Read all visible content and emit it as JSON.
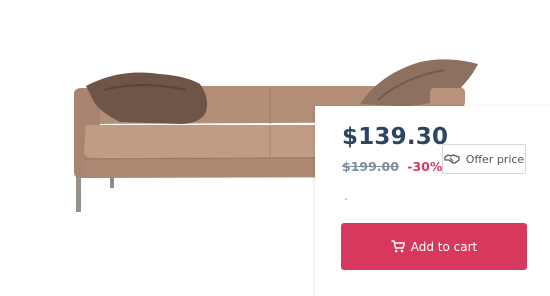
{
  "product": {
    "price_current": "$139.30",
    "price_old": "$199.00",
    "discount": "-30%"
  },
  "actions": {
    "offer_label": "Offer price",
    "cart_label": "Add to cart"
  },
  "icons": {
    "offer": "handshake-icon",
    "cart": "cart-icon"
  },
  "colors": {
    "accent": "#d6385e",
    "price": "#2c4660",
    "discount": "#d23a5e"
  }
}
